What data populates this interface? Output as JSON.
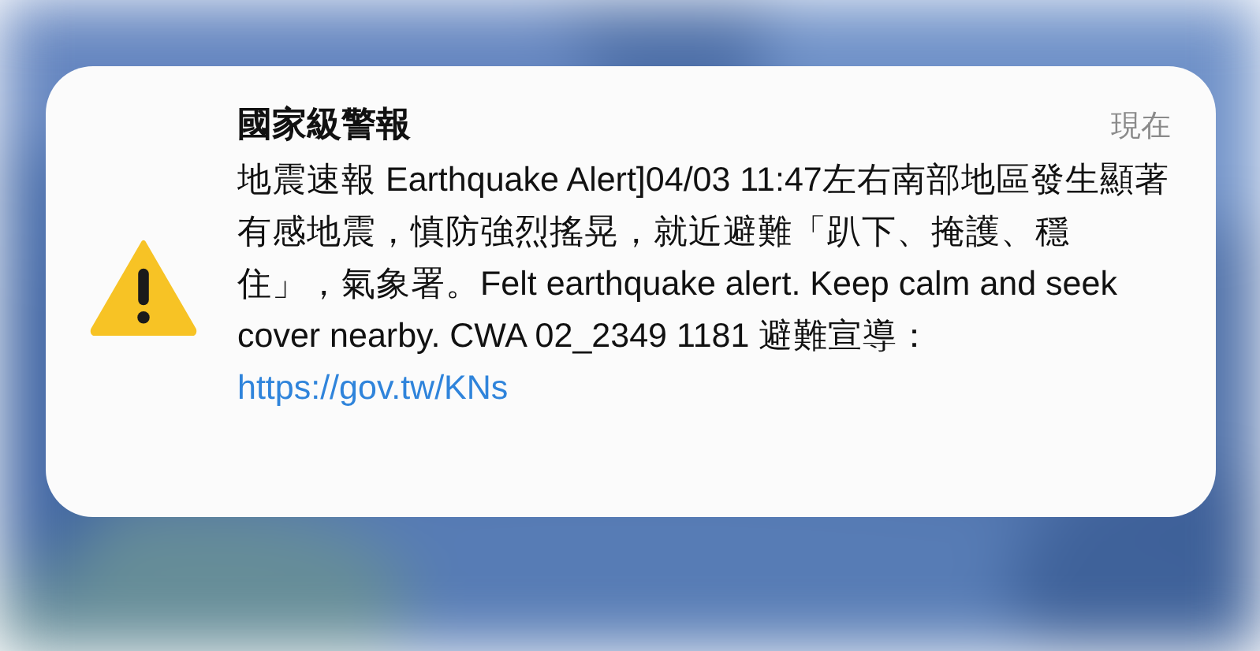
{
  "notification": {
    "title": "國家級警報",
    "time": "現在",
    "body": "地震速報 Earthquake Alert]04/03 11:47左右南部地區發生顯著有感地震，慎防強烈搖晃，就近避難「趴下、掩護、穩住」，氣象署。Felt earthquake alert. Keep calm and seek cover nearby. CWA 02_2349 1181 避難宣導：",
    "link": "https://gov.tw/KNs"
  }
}
